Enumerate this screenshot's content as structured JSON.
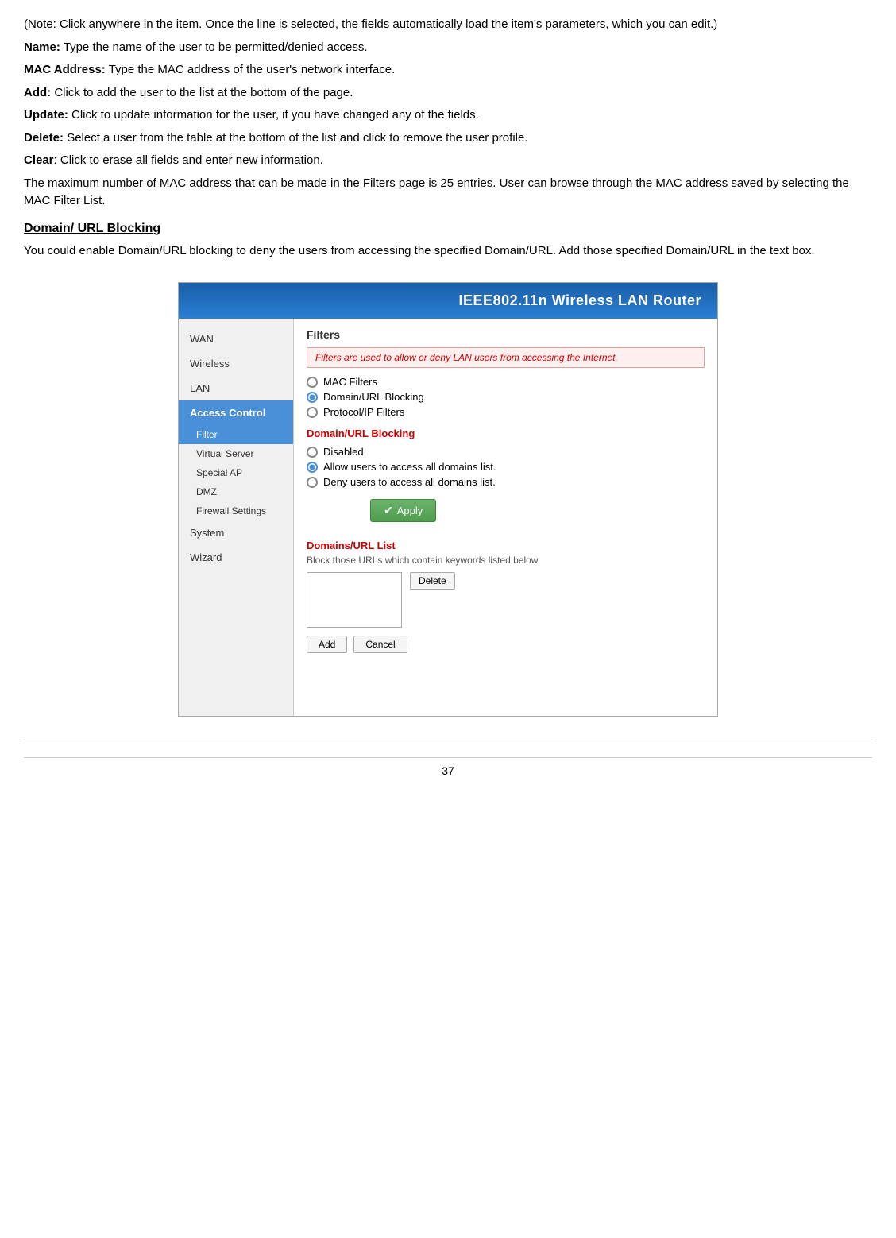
{
  "paragraphs": [
    {
      "id": "p1",
      "text": "(Note:  Click  anywhere  in  the  item.  Once  the  line  is  selected,  the  fields automatically load the item's parameters, which you can edit.)"
    },
    {
      "id": "p2",
      "bold": "Name:",
      "rest": " Type the name of the user to be permitted/denied access."
    },
    {
      "id": "p3",
      "bold": "MAC Address:",
      "rest": " Type the MAC address of the user's network interface."
    },
    {
      "id": "p4",
      "bold": "Add:",
      "rest": " Click to add the user to the list at the bottom of the page."
    },
    {
      "id": "p5",
      "bold": "Update:",
      "rest": " Click to update information for the user, if you have changed any of the fields."
    },
    {
      "id": "p6",
      "bold": "Delete:",
      "rest": " Select a user from the table at the bottom of the list and click to remove the user profile."
    },
    {
      "id": "p7",
      "bold": "Clear",
      "rest": ": Click to erase all fields and enter new information."
    },
    {
      "id": "p8",
      "text": "The maximum number of MAC address that can be made in the Filters page is 25 entries. User can browse through the MAC address saved by selecting the MAC Filter List."
    }
  ],
  "section_heading": "Domain/ URL Blocking",
  "section_body": "You  could  enable  Domain/URL  blocking  to  deny  the  users  from  accessing  the specified Domain/URL.  Add those specified Domain/URL in the text box.",
  "router": {
    "header": "IEEE802.11n  Wireless LAN Router",
    "sidebar": {
      "items": [
        {
          "label": "WAN",
          "type": "top"
        },
        {
          "label": "Wireless",
          "type": "top"
        },
        {
          "label": "LAN",
          "type": "top"
        },
        {
          "label": "Access Control",
          "type": "top-active"
        },
        {
          "label": "Filter",
          "type": "sub-active"
        },
        {
          "label": "Virtual Server",
          "type": "sub"
        },
        {
          "label": "Special AP",
          "type": "sub"
        },
        {
          "label": "DMZ",
          "type": "sub"
        },
        {
          "label": "Firewall Settings",
          "type": "sub"
        },
        {
          "label": "System",
          "type": "top"
        },
        {
          "label": "Wizard",
          "type": "top"
        }
      ]
    },
    "main": {
      "panel_title": "Filters",
      "notice": "Filters are used to allow or deny LAN users from accessing the Internet.",
      "filter_options": [
        {
          "label": "MAC Filters",
          "selected": false
        },
        {
          "label": "Domain/URL Blocking",
          "selected": true
        },
        {
          "label": "Protocol/IP Filters",
          "selected": false
        }
      ],
      "domain_blocking_title": "Domain/URL Blocking",
      "blocking_options": [
        {
          "label": "Disabled",
          "selected": false
        },
        {
          "label": "Allow users to access all domains list.",
          "selected": true
        },
        {
          "label": "Deny users to access all domains list.",
          "selected": false
        }
      ],
      "apply_label": "Apply",
      "domains_section_title": "Domains/URL List",
      "domains_desc": "Block those URLs which contain keywords listed below.",
      "delete_label": "Delete",
      "add_label": "Add",
      "cancel_label": "Cancel"
    }
  },
  "footer_page": "37"
}
